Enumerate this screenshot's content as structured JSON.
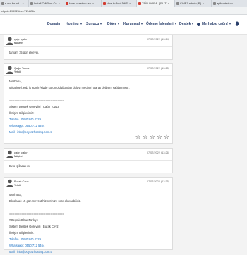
{
  "browser": {
    "tabs": [
      {
        "label": "e not found - ",
        "color": "#888888"
      },
      {
        "label": "Install CWP on Ce",
        "color": "#888888"
      },
      {
        "label": "How to set up rsy",
        "color": "#d33b2f"
      },
      {
        "label": "How to Add DNS",
        "color": "#d33b2f"
      },
      {
        "label": "TEİN DORA - [ELİT",
        "color": "#d33b2f"
      },
      {
        "label": "CWP7.admin [R] ",
        "color": "#888888"
      },
      {
        "label": "apikontrol.co",
        "color": "#888888"
      }
    ],
    "address": "ckpid=195526&c=V2c8Z6s"
  },
  "nav": {
    "items": [
      "Domain",
      "Hosting",
      "Sunucu",
      "Diğer",
      "Kurumsal",
      "Ödeme İşlemleri",
      "Destek"
    ],
    "user": "Merhaba, çağrı!"
  },
  "messages": [
    {
      "author": "çağrı çakır",
      "role": "Müşteri",
      "date": "07/07/2022 (13:24)",
      "lines": [
        "tamam 15 gün ekleyin."
      ]
    },
    {
      "author": "Çağrı Topuz",
      "role": "Yetkili",
      "date": "07/07/2022 (13:25)",
      "lines": [
        "Merhaba,",
        "Misafirsel; esb iş admin/sizde sorun olduğundan dolayı mecburi olarak değişim sağlanmıştır.",
        "",
        "================================",
        "Sistem Destek Görevlisi : Çağrı Topuz",
        "İletişim Bilgilerimiz:",
        "Telefon : 0850 840 4329",
        "Whatsapp : 0550 712 5464",
        "Mail : info@poyrazhosting.com.tr"
      ],
      "link_lines": [
        6,
        7,
        8
      ]
    },
    {
      "author": "çağrı çakır",
      "role": "Müşteri",
      "date": "07/07/2022 (13:26)",
      "lines": [
        "Evlo iş ilacak mı"
      ]
    },
    {
      "author": "Burak Cevz",
      "role": "Yetkili",
      "date": "07/07/2022 (13:35)",
      "lines": [
        "Merhaba,",
        "Ek olarak 15 gün mevcut hizmetinize süre eklenebiliriz.",
        "",
        "================================",
        "#GeçmişOlsunTürkiye",
        "Sistem Destek Görevlisi : Burak Cevz",
        "İletişim Bilgilerimiz:",
        "Telefon : 0850 840 4329",
        "Whatsapp : 0550 712 5464",
        "Mail : info@poyrazhosting.com.tr"
      ],
      "link_lines": [
        7,
        8,
        9
      ]
    }
  ],
  "rating_stars": 5
}
